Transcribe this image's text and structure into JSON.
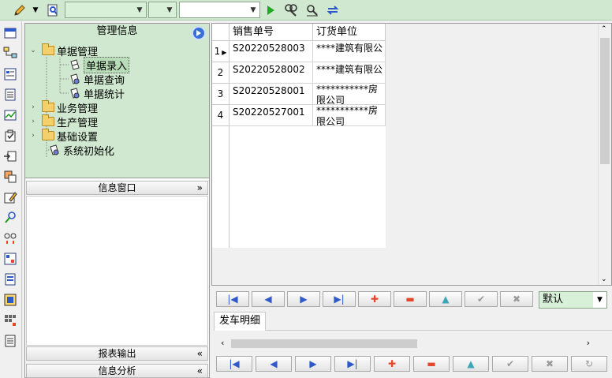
{
  "toolbar": {
    "combo1_value": "",
    "combo2_value": "",
    "combo3_value": ""
  },
  "tree": {
    "title": "管理信息",
    "nodes": [
      {
        "label": "单据管理"
      },
      {
        "label": "单据录入"
      },
      {
        "label": "单据查询"
      },
      {
        "label": "单据统计"
      },
      {
        "label": "业务管理"
      },
      {
        "label": "生产管理"
      },
      {
        "label": "基础设置"
      },
      {
        "label": "系统初始化"
      }
    ]
  },
  "panels": {
    "info_window": "信息窗口",
    "report_output": "报表输出",
    "info_analysis": "信息分析"
  },
  "grid": {
    "columns": [
      "销售单号",
      "订货单位"
    ],
    "rows": [
      {
        "num": "1",
        "order_no": "S20220528003",
        "unit": "****建筑有限公"
      },
      {
        "num": "2",
        "order_no": "S20220528002",
        "unit": "****建筑有限公"
      },
      {
        "num": "3",
        "order_no": "S20220528001",
        "unit": "***********房",
        "unit2": "限公司"
      },
      {
        "num": "4",
        "order_no": "S20220527001",
        "unit": "***********房",
        "unit2": "限公司"
      }
    ]
  },
  "view_select": {
    "value": "默认"
  },
  "tabs": [
    {
      "label": "发车明细"
    }
  ],
  "colors": {
    "green_bg": "#cfe8cf",
    "blue_icon": "#2f59c8",
    "red_icon": "#e5472b"
  }
}
